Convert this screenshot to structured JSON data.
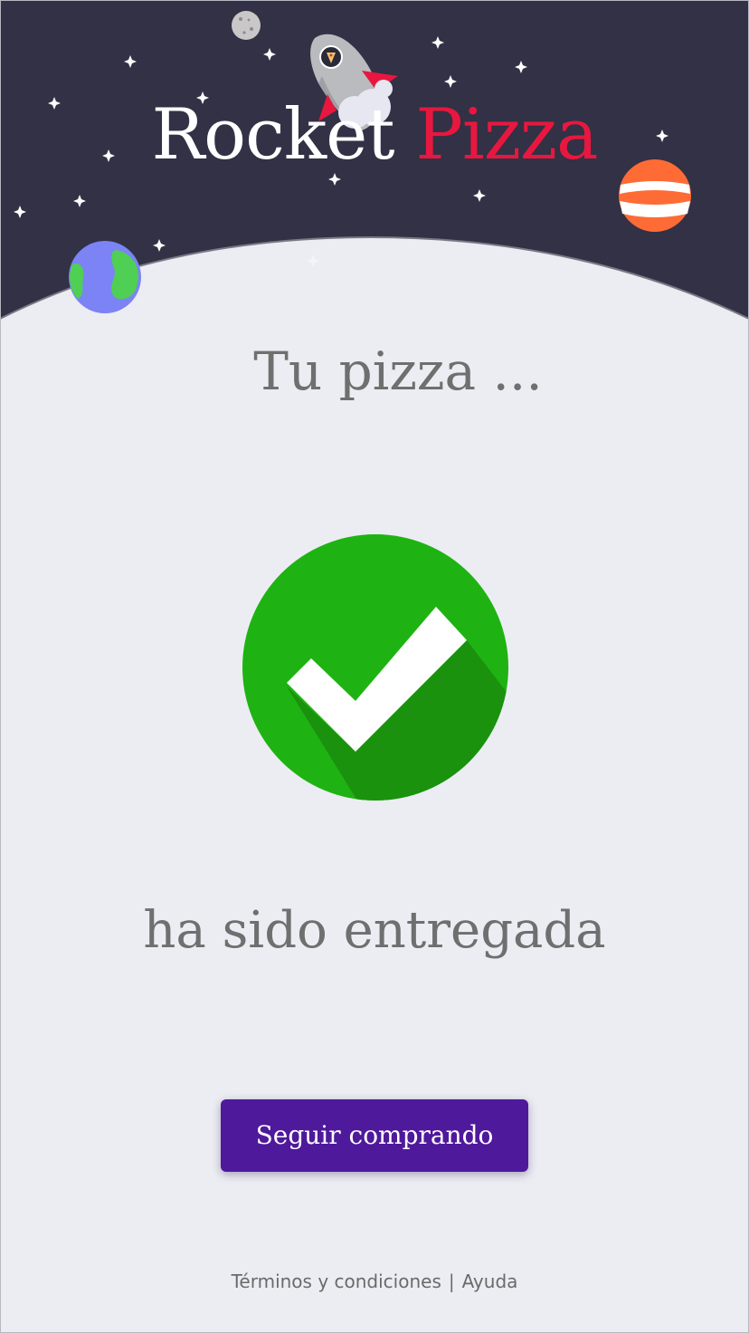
{
  "brand": {
    "word1": "Rocket",
    "word2": "Pizza",
    "word1_color": "#ffffff",
    "word2_color": "#e8173f"
  },
  "header": {
    "sky_color": "#323145",
    "icons": [
      "moon-icon",
      "rocket-icon",
      "pizza-slice-icon",
      "striped-planet-icon",
      "earth-icon",
      "star-icon"
    ]
  },
  "status": {
    "heading": "Tu pizza ...",
    "message": "ha sido entregada",
    "icon": "check-circle-icon",
    "icon_color": "#1eb312"
  },
  "actions": {
    "continue_label": "Seguir comprando",
    "continue_color": "#4f199b"
  },
  "footer": {
    "terms_label": "Términos y condiciones",
    "separator": "|",
    "help_label": "Ayuda"
  }
}
